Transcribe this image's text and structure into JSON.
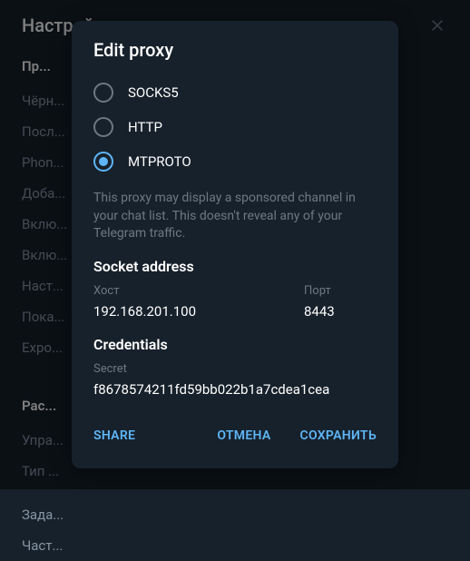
{
  "settings": {
    "title": "Настройки",
    "sections": {
      "section1_title": "Пр...",
      "items1": {
        "blacklist": "Чёрн...",
        "lastSeen": "Посл...",
        "phone": "Phon...",
        "add": "Доба...",
        "enable1": "Вклю...",
        "enable2": "Вклю...",
        "configure": "Наст...",
        "show": "Пока...",
        "expo": "Expo..."
      },
      "section2_title": "Рас...",
      "items2": {
        "manage": "Упра...",
        "type": "Тип ..."
      },
      "items3": {
        "task": "Зада...",
        "faq": "Част..."
      }
    }
  },
  "modal": {
    "title": "Edit proxy",
    "radios": {
      "socks5": "SOCKS5",
      "http": "HTTP",
      "mtproto": "MTPROTO"
    },
    "info": "This proxy may display a sponsored channel in your chat list. This doesn't reveal any of your Telegram traffic.",
    "socketAddress": "Socket address",
    "hostLabel": "Хост",
    "hostValue": "192.168.201.100",
    "portLabel": "Порт",
    "portValue": "8443",
    "credentials": "Credentials",
    "secretLabel": "Secret",
    "secretValue": "f8678574211fd59bb022b1a7cdea1cea",
    "actions": {
      "share": "SHARE",
      "cancel": "ОТМЕНА",
      "save": "СОХРАНИТЬ"
    }
  }
}
